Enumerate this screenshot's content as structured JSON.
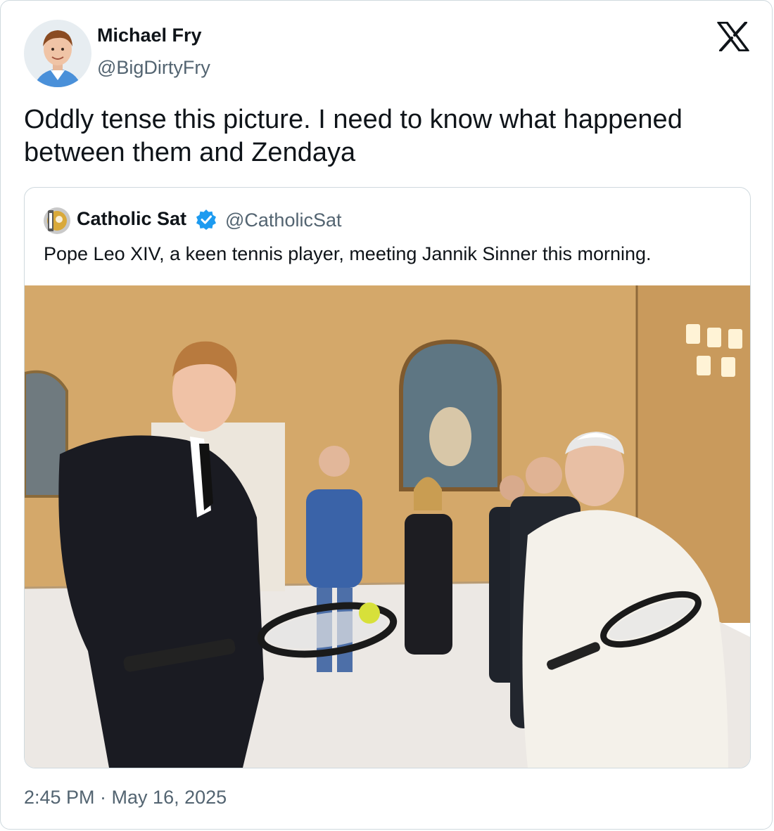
{
  "tweet": {
    "author_name": "Michael Fry",
    "author_handle": "@BigDirtyFry",
    "text": "Oddly tense this picture. I need to know what happened between them and Zendaya",
    "timestamp": "2:45 PM · May 16, 2025"
  },
  "quoted": {
    "author_name": "Catholic Sat",
    "author_handle": "@CatholicSat",
    "verified": true,
    "text": "Pope Leo XIV, a keen tennis player, meeting Jannik Sinner this morning."
  },
  "icons": {
    "platform_logo": "x-logo-icon",
    "verified_badge": "verified-badge-icon"
  },
  "colors": {
    "text_primary": "#0f1419",
    "text_secondary": "#536471",
    "border": "#cfd9de",
    "verified_blue": "#1d9bf0"
  }
}
